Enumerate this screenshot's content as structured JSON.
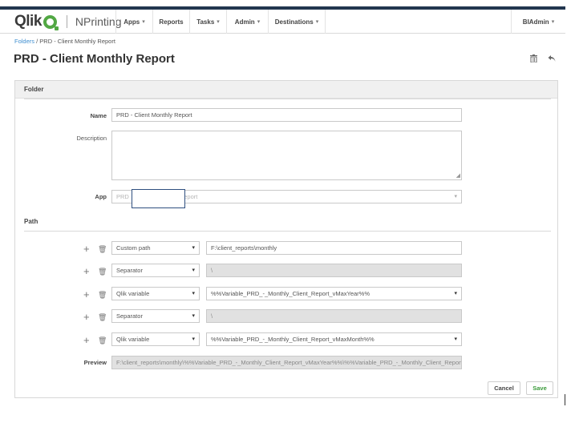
{
  "nav": {
    "brand": "Qlik",
    "product": "NPrinting",
    "items": [
      {
        "label": "Apps",
        "dropdown": true
      },
      {
        "label": "Reports",
        "dropdown": false
      },
      {
        "label": "Tasks",
        "dropdown": true
      },
      {
        "label": "Admin",
        "dropdown": true
      },
      {
        "label": "Destinations",
        "dropdown": true
      }
    ],
    "user": "BIAdmin",
    "caret": "▾"
  },
  "breadcrumb": {
    "root": "Folders",
    "sep": "/",
    "current": "PRD - Client Monthly Report"
  },
  "page": {
    "title": "PRD - Client Monthly Report"
  },
  "icons": {
    "delete": "trash-icon",
    "back": "undo-arrow-icon",
    "add": "plus-icon"
  },
  "folder": {
    "section_title": "Folder",
    "name_label": "Name",
    "name_value": "PRD - Client Monthly Report",
    "description_label": "Description",
    "description_value": "",
    "app_label": "App",
    "app_value_start": "PRD",
    "app_value_end": "Report"
  },
  "path": {
    "section_title": "Path",
    "rows": [
      {
        "type": "Custom path",
        "value": "F:\\client_reports\\monthly",
        "value_kind": "text"
      },
      {
        "type": "Separator",
        "value": "\\",
        "value_kind": "disabled"
      },
      {
        "type": "Qlik variable",
        "value": "%%Variable_PRD_-_Monthly_Client_Report_vMaxYear%%",
        "value_kind": "select"
      },
      {
        "type": "Separator",
        "value": "\\",
        "value_kind": "disabled"
      },
      {
        "type": "Qlik variable",
        "value": "%%Variable_PRD_-_Monthly_Client_Report_vMaxMonth%%",
        "value_kind": "select"
      }
    ],
    "preview_label": "Preview",
    "preview_value": "F:\\client_reports\\monthly\\%%Variable_PRD_-_Monthly_Client_Report_vMaxYear%%\\%%Variable_PRD_-_Monthly_Client_Report_v"
  },
  "actions": {
    "cancel": "Cancel",
    "save": "Save"
  },
  "colors": {
    "nav_stripe": "#22364f",
    "brand_green": "#52a844",
    "link": "#3f8fd0",
    "save_text": "#3a9a3a"
  }
}
